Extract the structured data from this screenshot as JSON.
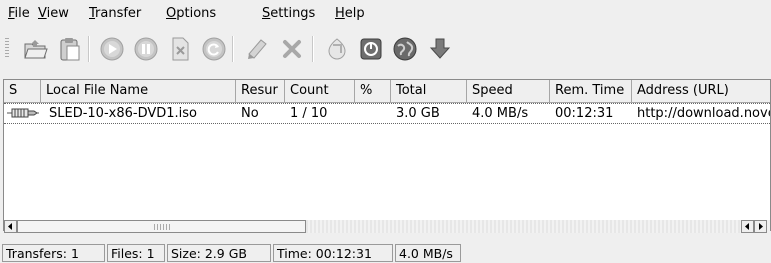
{
  "menu": [
    {
      "key": "file",
      "ul": "F",
      "rest": "ile"
    },
    {
      "key": "view",
      "ul": "V",
      "rest": "iew"
    },
    {
      "key": "transfer",
      "ul": "T",
      "rest": "ransfer"
    },
    {
      "key": "options",
      "ul": "O",
      "rest": "ptions"
    },
    {
      "key": "settings",
      "ul": "S",
      "rest": "ettings"
    },
    {
      "key": "help",
      "ul": "H",
      "rest": "elp"
    }
  ],
  "toolbar": {
    "icons": [
      "open-folder-icon",
      "paste-icon",
      "start-icon",
      "pause-icon",
      "delete-icon",
      "restart-icon",
      "clipboard-icon",
      "remove-icon",
      "drop-target-icon",
      "offline-mode-icon",
      "web-integration-icon",
      "download-arrow-icon"
    ]
  },
  "table": {
    "columns": [
      "S",
      "Local File Name",
      "Resur",
      "Count",
      "%",
      "Total",
      "Speed",
      "Rem. Time",
      "Address (URL)"
    ],
    "rows": [
      {
        "status_icon": "transfer-status-icon",
        "file": "SLED-10-x86-DVD1.iso",
        "resume": "No",
        "count": "1 / 10",
        "percent": "",
        "total": "3.0 GB",
        "speed": "4.0 MB/s",
        "remtime": "00:12:31",
        "url": "http://download.novell.com"
      }
    ]
  },
  "statusbar": {
    "transfers": "Transfers: 1",
    "files": "Files: 1",
    "size": "Size: 2.9 GB",
    "time": "Time: 00:12:31",
    "speed": "4.0 MB/s"
  }
}
